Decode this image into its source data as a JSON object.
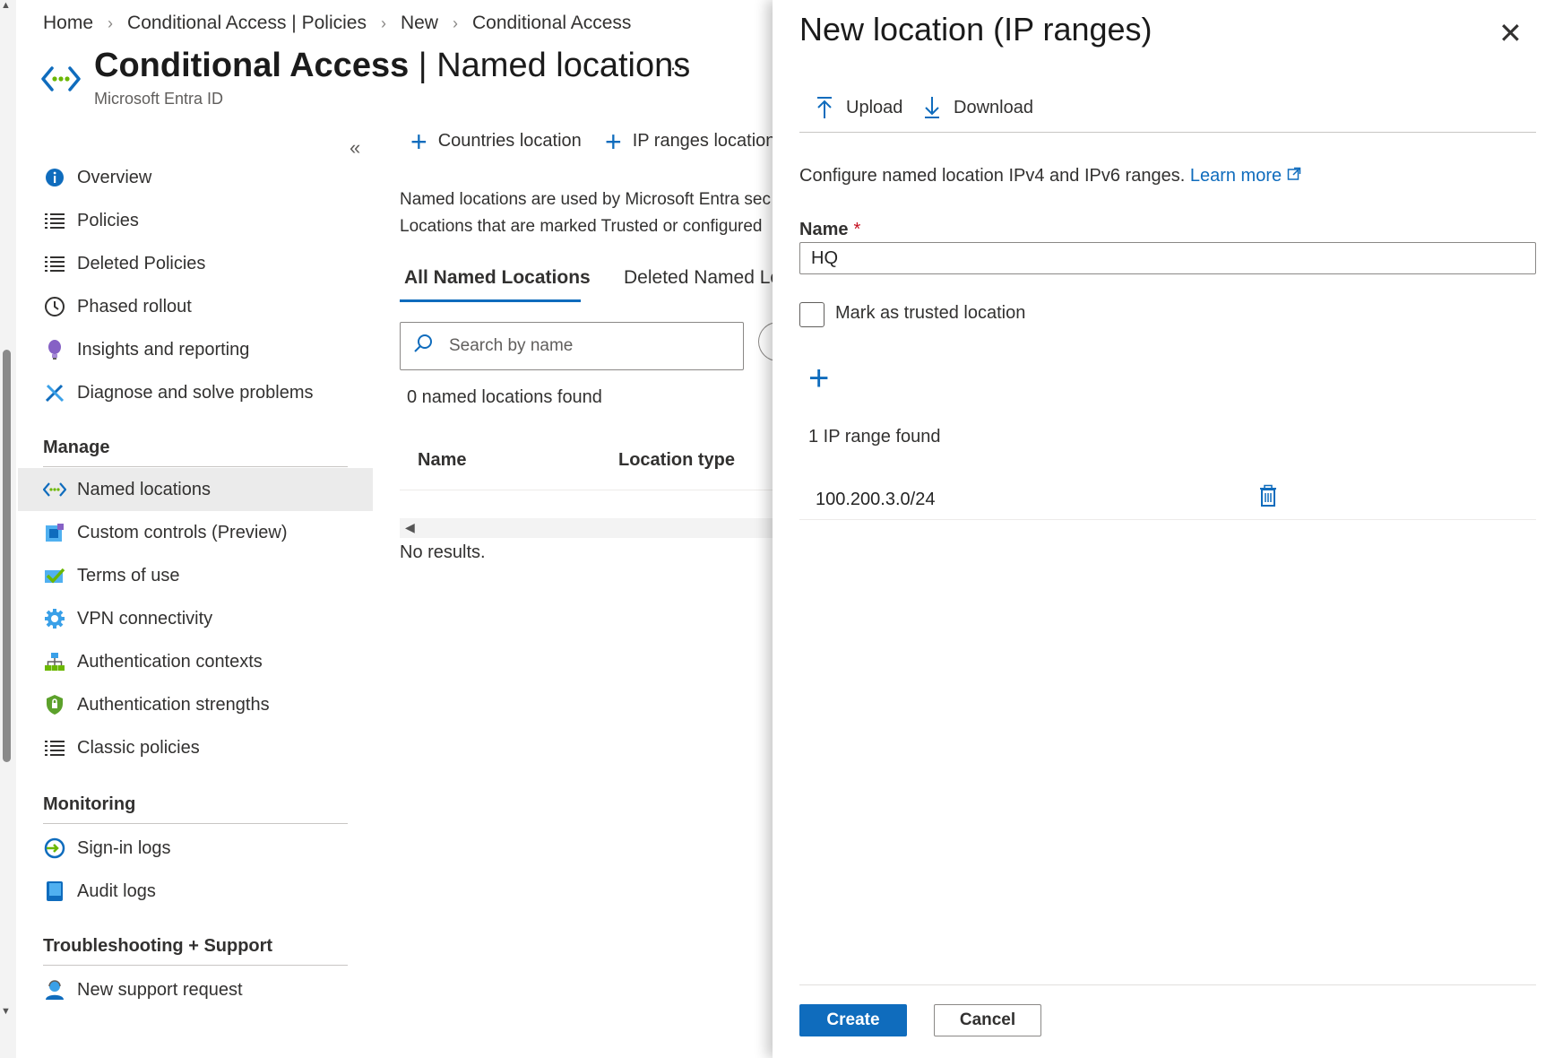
{
  "breadcrumb": [
    "Home",
    "Conditional Access | Policies",
    "New",
    "Conditional Access"
  ],
  "header": {
    "title_bold": "Conditional Access",
    "title_sep": " | ",
    "title_rest": "Named locations",
    "subtitle": "Microsoft Entra ID",
    "more": "..."
  },
  "sidebar": {
    "collapse": "«",
    "items": [
      {
        "label": "Overview",
        "icon": "info-icon"
      },
      {
        "label": "Policies",
        "icon": "list-icon"
      },
      {
        "label": "Deleted Policies",
        "icon": "list-icon"
      },
      {
        "label": "Phased rollout",
        "icon": "clock-icon"
      },
      {
        "label": "Insights and reporting",
        "icon": "lightbulb-icon"
      },
      {
        "label": "Diagnose and solve problems",
        "icon": "tools-icon"
      }
    ],
    "manage_header": "Manage",
    "manage": [
      {
        "label": "Named locations",
        "icon": "named-locations-icon",
        "active": true
      },
      {
        "label": "Custom controls (Preview)",
        "icon": "custom-controls-icon"
      },
      {
        "label": "Terms of use",
        "icon": "terms-check-icon"
      },
      {
        "label": "VPN connectivity",
        "icon": "gear-icon"
      },
      {
        "label": "Authentication contexts",
        "icon": "hierarchy-icon"
      },
      {
        "label": "Authentication strengths",
        "icon": "shield-icon"
      },
      {
        "label": "Classic policies",
        "icon": "list-icon"
      }
    ],
    "monitoring_header": "Monitoring",
    "monitoring": [
      {
        "label": "Sign-in logs",
        "icon": "sign-in-icon"
      },
      {
        "label": "Audit logs",
        "icon": "audit-book-icon"
      }
    ],
    "support_header": "Troubleshooting + Support",
    "support": [
      {
        "label": "New support request",
        "icon": "support-person-icon"
      }
    ]
  },
  "main": {
    "commands": [
      "Countries location",
      "IP ranges location"
    ],
    "description_line1": "Named locations are used by Microsoft Entra sec",
    "description_line2": "Locations that are marked Trusted or configured",
    "tabs": [
      "All Named Locations",
      "Deleted Named Lo"
    ],
    "search_placeholder": "Search by name",
    "count": "0 named locations found",
    "columns": [
      "Name",
      "Location type"
    ],
    "no_results": "No results."
  },
  "panel": {
    "title": "New location (IP ranges)",
    "close": "✕",
    "upload": "Upload",
    "download": "Download",
    "description": "Configure named location IPv4 and IPv6 ranges.",
    "learn_more": "Learn more",
    "name_label": "Name",
    "required_mark": "*",
    "name_value": "HQ",
    "trusted_label": "Mark as trusted location",
    "trusted_checked": false,
    "add_symbol": "+",
    "ip_count": "1 IP range found",
    "ip_ranges": [
      "100.200.3.0/24"
    ],
    "create_label": "Create",
    "cancel_label": "Cancel"
  },
  "colors": {
    "accent": "#0f6cbd",
    "active_nav": "#ebebeb",
    "required": "#c50f1f"
  }
}
